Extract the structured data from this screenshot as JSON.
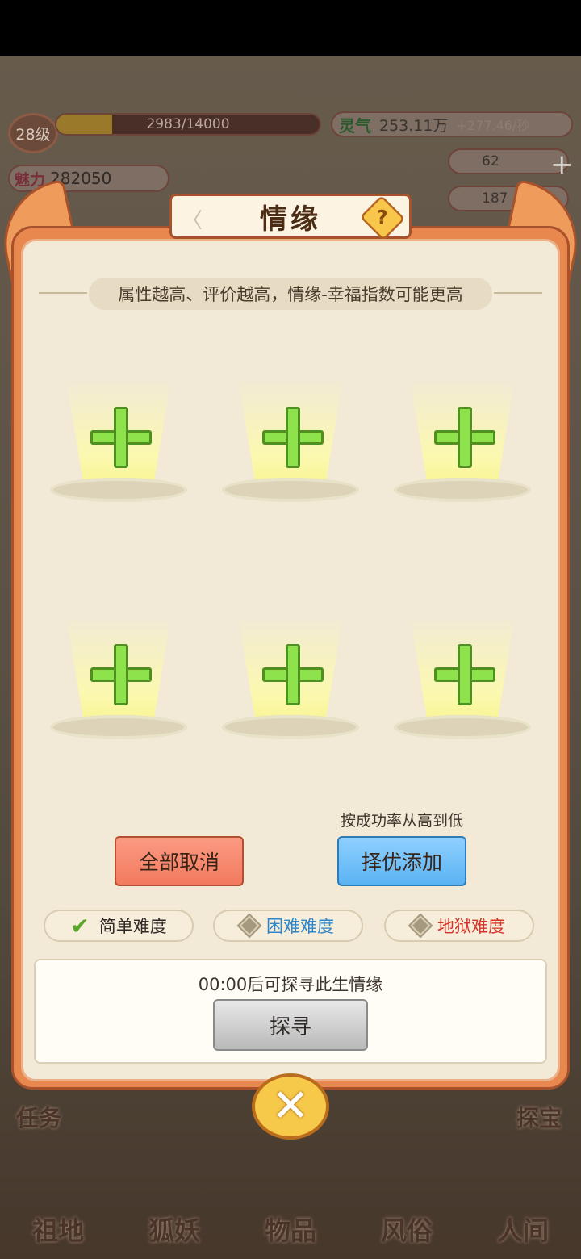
{
  "hud": {
    "level": "28级",
    "exp": "2983/14000",
    "exp_progress": 0.213,
    "charm_label": "魅力",
    "charm_value": "282050",
    "spirit_label": "灵气",
    "spirit_value": "253.11万",
    "spirit_rate": "+277.46/秒",
    "item1_value": "62",
    "item2_value": "187"
  },
  "dialog": {
    "title": "情缘",
    "hint": "属性越高、评价越高，情缘-幸福指数可能更高",
    "slots": [
      "+",
      "+",
      "+",
      "+",
      "+",
      "+"
    ],
    "sort_hint": "按成功率从高到低",
    "cancel_all": "全部取消",
    "auto_add": "择优添加",
    "difficulties": [
      {
        "label": "简单难度",
        "selected": true
      },
      {
        "label": "困难难度",
        "selected": false
      },
      {
        "label": "地狱难度",
        "selected": false
      }
    ],
    "explore_status": "00:00后可探寻此生情缘",
    "explore_button": "探寻"
  },
  "nav": {
    "items": [
      "祖地",
      "狐妖",
      "物品",
      "风俗",
      "人间"
    ],
    "task": "任务",
    "treasure": "探宝"
  },
  "colors": {
    "frame": "#e8884f",
    "panel": "#f2ead6",
    "plus_green": "#8ee24b",
    "easy_text": "#2f2a27",
    "hard_text": "#2e86c8",
    "hell_text": "#d3352a"
  },
  "icons": [
    "help-icon",
    "close-icon",
    "check-icon",
    "diamond-icon",
    "plus-icon"
  ]
}
